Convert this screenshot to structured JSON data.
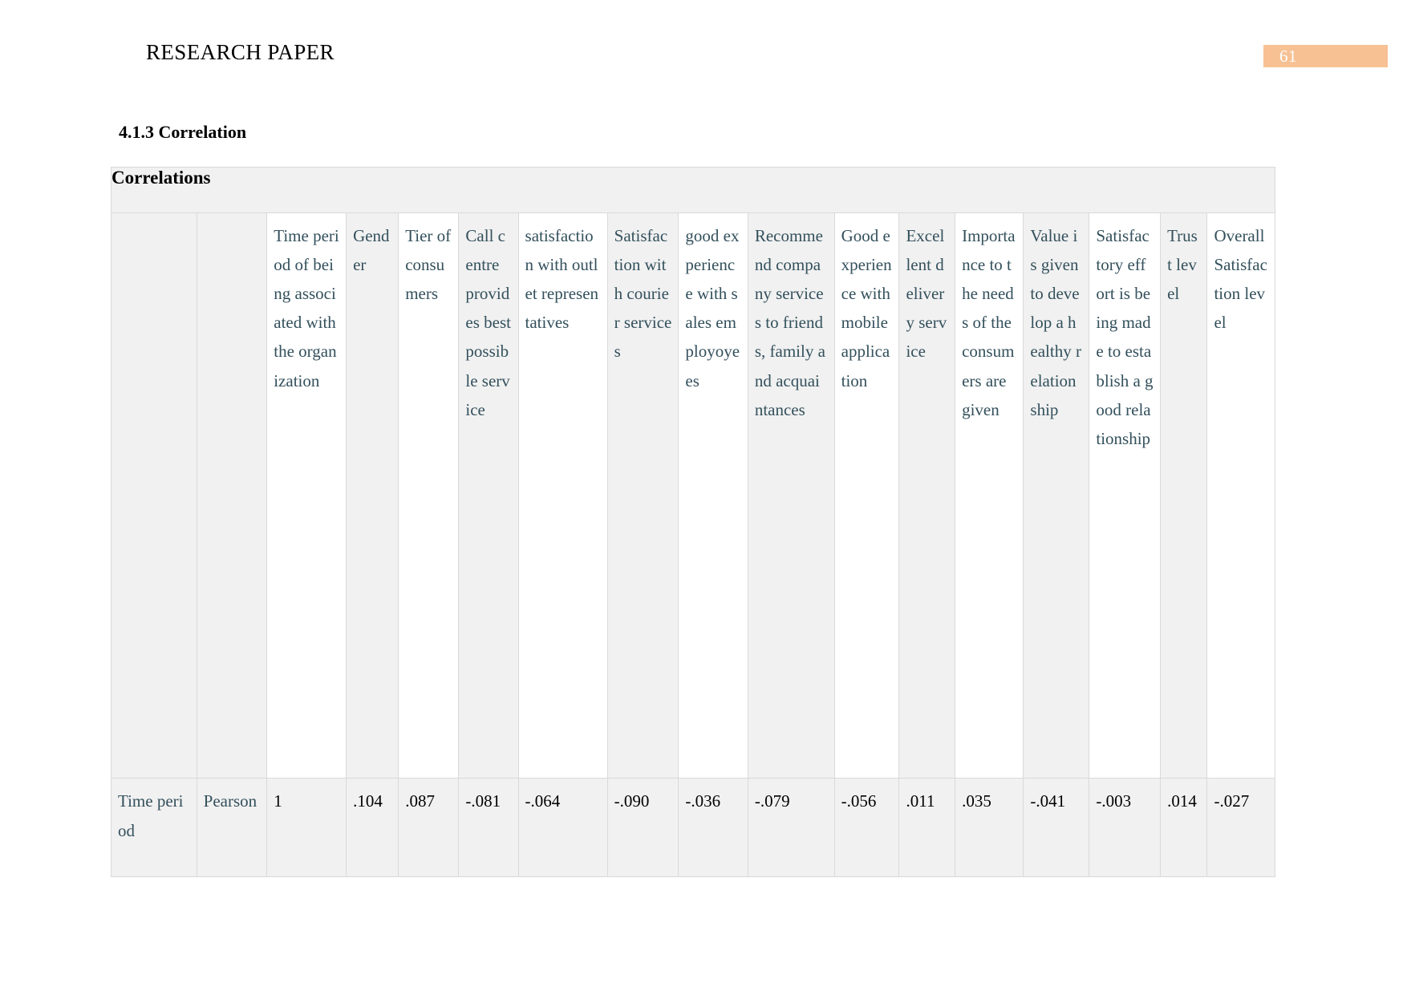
{
  "header": {
    "running_title": "RESEARCH PAPER",
    "page_number": "61",
    "badge_color": "#f7c194"
  },
  "section": {
    "heading": "4.1.3 Correlation"
  },
  "table": {
    "caption": "Correlations",
    "stub_headers": [
      "",
      ""
    ],
    "column_headers": [
      "Time period of being associated with the organization",
      "Gender",
      "Tier of consumers",
      "Call centre provides best possible service",
      "satisfaction with outlet representatives",
      "Satisfaction with courier services",
      "good experience with sales employoyees",
      "Recommend company services to friends, family and acquaintances",
      "Good experience with mobile application",
      "Excellent delivery service",
      "Importance to the needs of the consumers are given",
      "Value is given to develop a healthy relationship",
      "Satisfactory effort is being made to establish a good relationship",
      "Trust level",
      "Overall Satisfaction level"
    ],
    "rows": [
      {
        "label": "Time period",
        "statistic": "Pearson",
        "values": [
          "1",
          ".104",
          ".087",
          "-.081",
          "-.064",
          "-.090",
          "-.036",
          "-.079",
          "-.056",
          ".011",
          ".035",
          "-.041",
          "-.003",
          ".014",
          "-.027"
        ]
      }
    ],
    "colors": {
      "header_text": "#33505c",
      "shade": "#f1f1f1",
      "border": "#d9d9d9"
    }
  }
}
